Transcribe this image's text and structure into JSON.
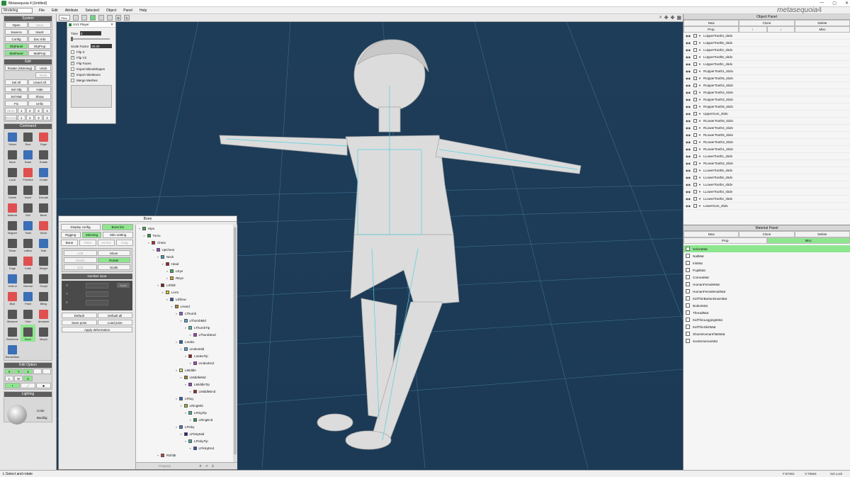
{
  "window": {
    "title": "Metasequoia 4 [Untitled]",
    "controls": [
      "—",
      "▢",
      "✕"
    ]
  },
  "menubar": {
    "mode": "Modeling",
    "items": [
      "File",
      "Edit",
      "Attribute",
      "Selected",
      "Object",
      "Panel",
      "Help"
    ]
  },
  "brand": {
    "name": "metasequoia",
    "version": "4"
  },
  "toolbar": {
    "view": "Pers."
  },
  "left": {
    "system": {
      "title": "System",
      "buttons": [
        [
          "Open",
          "Save"
        ],
        [
          "SaveAs",
          "Insert"
        ],
        [
          "Config",
          "Doc Info"
        ],
        [
          "ObjPanel",
          "ObjProp"
        ],
        [
          "MatPanel",
          "MatProp"
        ]
      ]
    },
    "edit": {
      "title": "Edit",
      "rows": [
        [
          "Rotate (Skinning)",
          "Undo"
        ],
        [
          "",
          "Redo"
        ],
        [
          "Sel All",
          "Unsel All"
        ],
        [
          "Sel Obj",
          "Hide"
        ],
        [
          "Sel Mat",
          "Show"
        ],
        [
          "Fix",
          "Unfix"
        ]
      ],
      "store_label": "Store",
      "restore_label": "Restore",
      "slots": [
        "1",
        "2",
        "3",
        "4"
      ]
    },
    "command": {
      "title": "Command",
      "items": [
        "Select",
        "Rect",
        "Rope",
        "Move",
        "Scale",
        "Rotate",
        "Local",
        "Primitive",
        "Create",
        "Delete",
        "Insert",
        "Extrude",
        "Material",
        "Roll",
        "Bevel",
        "Magnet",
        "Twist",
        "Bend",
        "Shear",
        "Lattice",
        "Hole",
        "Edge",
        "Knife",
        "Weight",
        "VertCol",
        "Normal",
        "Sculpt",
        "Blob",
        "Paint",
        "Biting",
        "Measure",
        "View",
        "Armature",
        "RefsDone",
        "Bone",
        "Morph",
        "RenderMan"
      ]
    },
    "edit_option": {
      "title": "Edit Option",
      "axes": [
        "X",
        "Y",
        "Z"
      ],
      "coords": [
        "L",
        "W",
        "S"
      ]
    },
    "lighting": {
      "title": "Lighting",
      "color_label": "Color",
      "backlight_label": "Backlig"
    }
  },
  "uv_player": {
    "title": "UV2 Player",
    "time_label": "Time",
    "time_value": "0",
    "scale_label": "Scale Factor",
    "scale_value": "20.00",
    "options": [
      {
        "label": "Flip X",
        "checked": false
      },
      {
        "label": "Flip YZ",
        "checked": true
      },
      {
        "label": "Flip Faces",
        "checked": true
      },
      {
        "label": "Import Blendshapes",
        "checked": false
      },
      {
        "label": "Import Skeletons",
        "checked": true
      },
      {
        "label": "Merge Meshes",
        "checked": false
      }
    ]
  },
  "rigging": {
    "title": "Bone",
    "tabs": {
      "display": "Display config.",
      "bonelist": "Bone list",
      "rigging": "Rigging",
      "skinning": "Skinning",
      "skinsetting": "Skin setting",
      "bone": "Bone",
      "paint": "Paint",
      "anchor": "Anchor",
      "copy": "Copy"
    },
    "ops": [
      [
        "Add",
        "Move"
      ],
      [
        "Delete",
        "Rotate"
      ],
      [
        "Edit",
        "Scale"
      ]
    ],
    "number_input": {
      "title": "Number input",
      "x": "X",
      "y": "Y",
      "z": "Z",
      "apply": "Apply"
    },
    "actions": [
      [
        "Default",
        "Default all"
      ],
      [
        "Save pose",
        "Load pose"
      ]
    ],
    "apply_deformation": "Apply deformation",
    "property_label": "Property",
    "tree": [
      {
        "name": "Hips",
        "color": "#3db24a",
        "depth": 0
      },
      {
        "name": "Torso",
        "color": "#2a9a3a",
        "depth": 1
      },
      {
        "name": "Chest",
        "color": "#c02828",
        "depth": 2
      },
      {
        "name": "UpChest",
        "color": "#9a40c8",
        "depth": 3
      },
      {
        "name": "Neck",
        "color": "#3ca0c8",
        "depth": 4
      },
      {
        "name": "Head",
        "color": "#a02020",
        "depth": 5
      },
      {
        "name": "LEye",
        "color": "#3db24a",
        "depth": 6
      },
      {
        "name": "REye",
        "color": "#e0a020",
        "depth": 6
      },
      {
        "name": "LShldr",
        "color": "#8a1a1a",
        "depth": 4
      },
      {
        "name": "LArm",
        "color": "#d8d020",
        "depth": 5
      },
      {
        "name": "LElbow",
        "color": "#3050c0",
        "depth": 6
      },
      {
        "name": "LHand",
        "color": "#c08020",
        "depth": 7
      },
      {
        "name": "LThumb",
        "color": "#9060d0",
        "depth": 8
      },
      {
        "name": "LThumbMid",
        "color": "#40a8d0",
        "depth": 9
      },
      {
        "name": "LThumbTip",
        "color": "#40c0b0",
        "depth": 10
      },
      {
        "name": "LThumbEnd",
        "color": "#a040c0",
        "depth": 11
      },
      {
        "name": "LIndex",
        "color": "#2060c0",
        "depth": 8
      },
      {
        "name": "LIndexMid",
        "color": "#40a8d0",
        "depth": 9
      },
      {
        "name": "LIndexTip",
        "color": "#a02020",
        "depth": 10
      },
      {
        "name": "LIndexEnd",
        "color": "#a040c0",
        "depth": 11
      },
      {
        "name": "LMiddle",
        "color": "#d8e060",
        "depth": 8
      },
      {
        "name": "LMiddleMid",
        "color": "#a08020",
        "depth": 9
      },
      {
        "name": "LMiddleTip",
        "color": "#9040c0",
        "depth": 10
      },
      {
        "name": "LMiddleEnd",
        "color": "#a02020",
        "depth": 11
      },
      {
        "name": "LRing",
        "color": "#3060c0",
        "depth": 8
      },
      {
        "name": "LRingMid",
        "color": "#90c030",
        "depth": 9
      },
      {
        "name": "LRingTip",
        "color": "#40b0a0",
        "depth": 10
      },
      {
        "name": "LRingEnd",
        "color": "#2a9a5a",
        "depth": 11
      },
      {
        "name": "LPinky",
        "color": "#3c7ad0",
        "depth": 8
      },
      {
        "name": "LPinkyMid",
        "color": "#202090",
        "depth": 9
      },
      {
        "name": "LPinkyTip",
        "color": "#40b0a0",
        "depth": 10
      },
      {
        "name": "LPinkyEnd",
        "color": "#3050c0",
        "depth": 11
      },
      {
        "name": "RShldr",
        "color": "#c04040",
        "depth": 4
      }
    ]
  },
  "object_panel": {
    "title": "Object Panel",
    "buttons": [
      "New",
      "Clone",
      "Delete"
    ],
    "buttons2": [
      "Prop",
      "↑",
      "↓",
      "Misc"
    ],
    "objects": [
      "LUpperTooth3_sbdv",
      "LUpperTooth6_sbdv",
      "LUpperTooth2_sbdv",
      "LUpperTooth5_sbdv",
      "LUpperTooth1_sbdv",
      "RUpperTooth1_sbdv",
      "RUpperTooth6_sbdv",
      "RUpperTooth2_sbdv",
      "RUpperTooth4_sbdv",
      "RUpperTooth3_sbdv",
      "RUpperTooth5_sbdv",
      "UpperGum_sbdv",
      "RLowerTooth6_sbdv",
      "RLowerTooth4_sbdv",
      "RLowerTooth5_sbdv",
      "RLowerTooth3_sbdv",
      "RLowerTooth1_sbdv",
      "LLowerTooth1_sbdv",
      "RLowerTooth2_sbdv",
      "LLowerTooth5_sbdv",
      "LLowerTooth6_sbdv",
      "LLowerTooth4_sbdv",
      "LLowerTooth3_sbdv",
      "LLowerTooth2_sbdv",
      "LowerGum_sbdv"
    ]
  },
  "material_panel": {
    "title": "Material Panel",
    "buttons": [
      "New",
      "Clone",
      "Delete"
    ],
    "buttons2": [
      "Prop",
      "Misc"
    ],
    "materials": [
      "ScleraMat",
      "NailMat",
      "IrisMat",
      "PupilMat",
      "CorneaMat",
      "HumanFemaleMat",
      "HumanFemaleHairMat",
      "KidThinButtonDownMat",
      "ButtonMat",
      "ThreadMat",
      "KidThinLeggingsMat",
      "KidThinSkirtMat",
      "ShoesHumanFlatsMat",
      "SocksHumanMat"
    ],
    "selected_index": 0
  },
  "status": {
    "message": "L:Select and rotate",
    "poly": "F:87381",
    "vert": "V:75664",
    "lock": "Sel Lock"
  }
}
